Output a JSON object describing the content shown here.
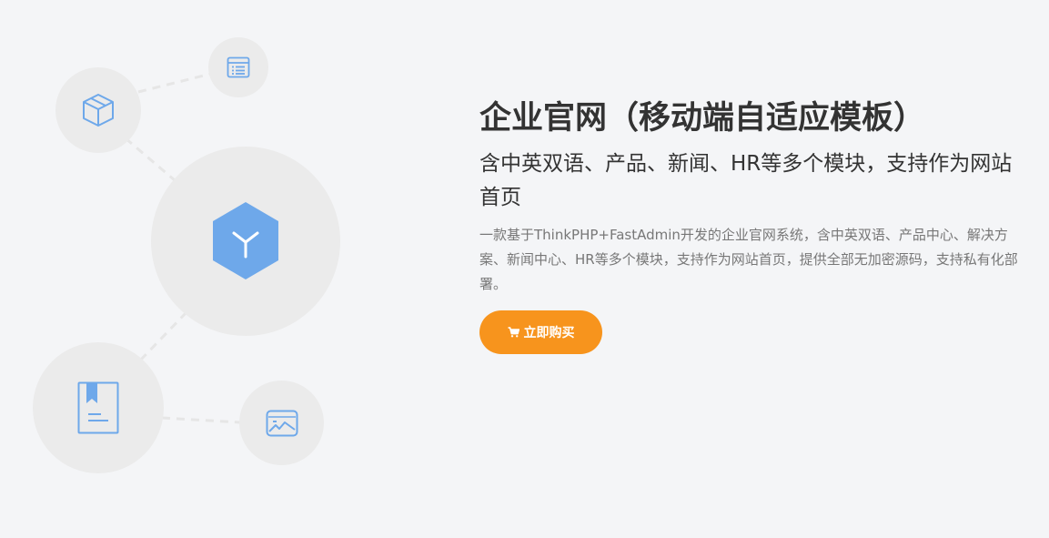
{
  "hero": {
    "title": "企业官网（移动端自适应模板）",
    "subtitle": "含中英双语、产品、新闻、HR等多个模块，支持作为网站首页",
    "description": "一款基于ThinkPHP+FastAdmin开发的企业官网系统，含中英双语、产品中心、解决方案、新闻中心、HR等多个模块，支持作为网站首页，提供全部无加密源码，支持私有化部署。",
    "buy_label": "立即购买"
  },
  "icons": [
    "list-icon",
    "box-icon",
    "hexagon-logo-icon",
    "book-icon",
    "image-card-icon",
    "cart-icon"
  ],
  "colors": {
    "accent": "#f7941d",
    "icon_blue": "#6ea8ea",
    "bubble": "#ebebeb",
    "background": "#f4f5f7"
  }
}
